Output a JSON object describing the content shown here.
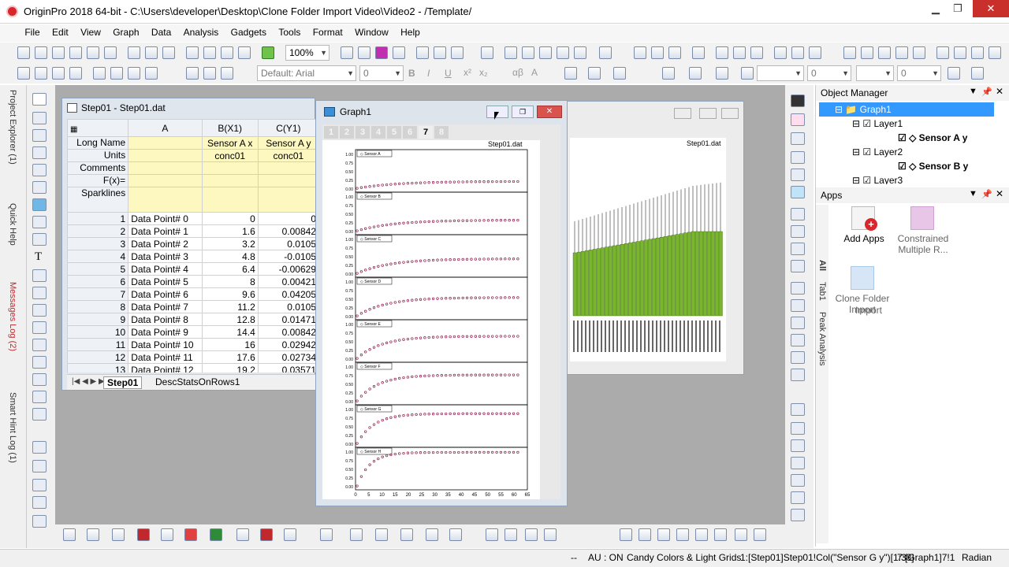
{
  "window": {
    "title": "OriginPro 2018 64-bit - C:\\Users\\developer\\Desktop\\Clone Folder Import Video\\Video2 - /Template/"
  },
  "menu": [
    "File",
    "Edit",
    "View",
    "Graph",
    "Data",
    "Analysis",
    "Gadgets",
    "Tools",
    "Format",
    "Window",
    "Help"
  ],
  "toolbar": {
    "zoom": "100%",
    "font": "Default: Arial",
    "font_size": "0",
    "size2": "0",
    "size3": "0"
  },
  "left_dock": {
    "tabs": [
      "Project Explorer (1)",
      "Quick Help",
      "Messages Log (2)",
      "Smart Hint Log (1)"
    ]
  },
  "worksheet": {
    "title": "Step01 - Step01.dat",
    "columns": [
      "A",
      "B(X1)",
      "C(Y1)"
    ],
    "meta_rows": [
      {
        "label": "Long Name",
        "b": "Sensor A x",
        "c": "Sensor A y"
      },
      {
        "label": "Units",
        "b": "conc01",
        "c": "conc01"
      },
      {
        "label": "Comments",
        "b": "",
        "c": ""
      },
      {
        "label": "F(x)=",
        "b": "",
        "c": ""
      },
      {
        "label": "Sparklines",
        "b": "",
        "c": ""
      }
    ],
    "rows": [
      [
        "1",
        "Data Point# 0",
        "0",
        "0"
      ],
      [
        "2",
        "Data Point# 1",
        "1.6",
        "0.00842"
      ],
      [
        "3",
        "Data Point# 2",
        "3.2",
        "0.0105"
      ],
      [
        "4",
        "Data Point# 3",
        "4.8",
        "-0.0105"
      ],
      [
        "5",
        "Data Point# 4",
        "6.4",
        "-0.00629"
      ],
      [
        "6",
        "Data Point# 5",
        "8",
        "0.00421"
      ],
      [
        "7",
        "Data Point# 6",
        "9.6",
        "0.04205"
      ],
      [
        "8",
        "Data Point# 7",
        "11.2",
        "0.0105"
      ],
      [
        "9",
        "Data Point# 8",
        "12.8",
        "0.01471"
      ],
      [
        "10",
        "Data Point# 9",
        "14.4",
        "0.00842"
      ],
      [
        "11",
        "Data Point# 10",
        "16",
        "0.02942"
      ],
      [
        "12",
        "Data Point# 11",
        "17.6",
        "0.02734"
      ],
      [
        "13",
        "Data Point# 12",
        "19.2",
        "0.03571"
      ]
    ],
    "sheet_tabs": [
      "Step01",
      "DescStatsOnRows1"
    ]
  },
  "graph_window": {
    "title": "Graph1",
    "layer_tabs": [
      "1",
      "2",
      "3",
      "4",
      "5",
      "6",
      "7",
      "8"
    ],
    "active_tab": "7",
    "file_label": "Step01.dat",
    "panel_labels": [
      "Sensor A",
      "Sensor B",
      "Sensor C",
      "Sensor D",
      "Sensor E",
      "Sensor F",
      "Sensor G",
      "Sensor H"
    ],
    "y_ticks": [
      "1.00",
      "0.75",
      "0.50",
      "0.25",
      "0.00"
    ],
    "x_ticks": [
      "0",
      "5",
      "10",
      "15",
      "20",
      "25",
      "30",
      "35",
      "40",
      "45",
      "50",
      "55",
      "60",
      "65"
    ]
  },
  "back_graph": {
    "file_label": "Step01.dat"
  },
  "object_manager": {
    "title": "Object Manager",
    "items": [
      {
        "label": "Graph1",
        "level": 0
      },
      {
        "label": "Layer1",
        "level": 1
      },
      {
        "label": "Sensor A y",
        "level": 2
      },
      {
        "label": "Layer2",
        "level": 1
      },
      {
        "label": "Sensor B y",
        "level": 2
      },
      {
        "label": "Layer3",
        "level": 1
      }
    ]
  },
  "apps": {
    "title": "Apps",
    "items": [
      "Add Apps",
      "Constrained Multiple R...",
      "Clone Folder Import"
    ],
    "side_tabs": [
      "All",
      "Tab1",
      "Peak Analysis"
    ]
  },
  "status": {
    "au": "AU : ON",
    "theme": "Candy Colors & Light Grids",
    "selection": "1:[Step01]Step01!Col(\"Sensor G y\")[1:38]",
    "active": "7:[Graph1]7!1",
    "angle": "Radian"
  }
}
